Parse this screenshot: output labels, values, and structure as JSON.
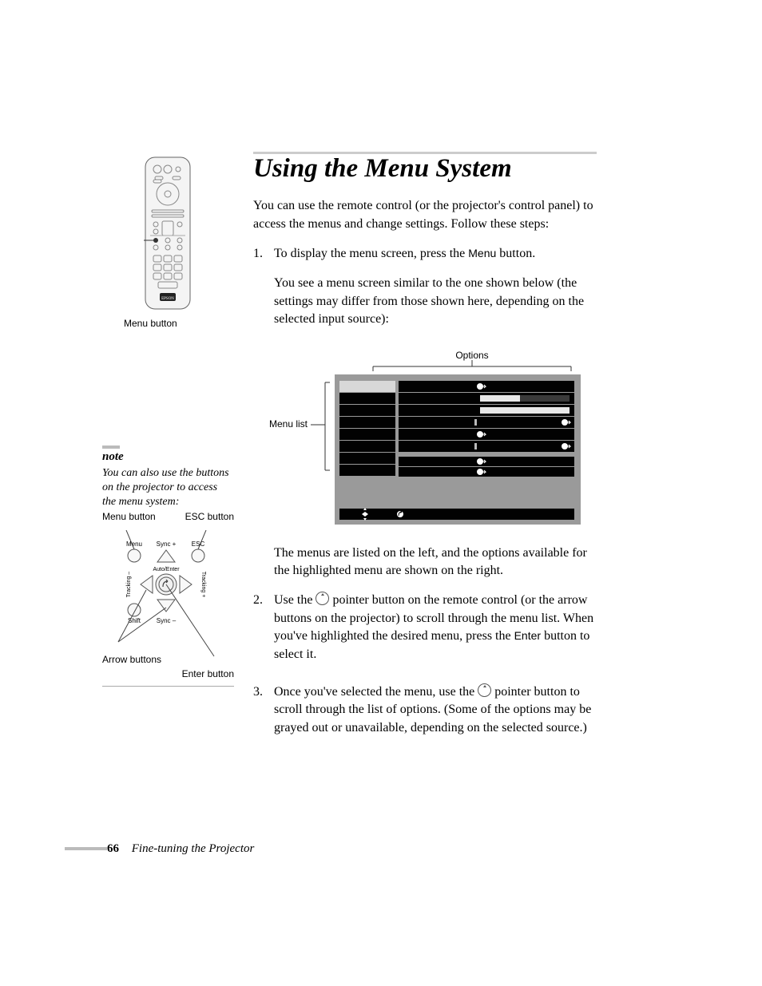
{
  "heading": "Using the Menu System",
  "intro": "You can use the remote control (or the projector's control panel) to access the menus and change settings. Follow these steps:",
  "steps": {
    "s1_num": "1.",
    "s1_a_pre": "To display the menu screen, press the ",
    "s1_a_ui": "Menu",
    "s1_a_post": " button.",
    "s1_b": "You see a menu screen similar to the one shown below (the settings may differ from those shown here, depending on the selected input source):",
    "s_mid": "The menus are listed on the left, and the options available for the highlighted menu are shown on the right.",
    "s2_num": "2.",
    "s2_pre": "Use the ",
    "s2_mid": " pointer button on the remote control (or the arrow buttons on the projector) to scroll through the menu list. When you've highlighted the desired menu, press the ",
    "s2_ui": "Enter",
    "s2_post": " button to select it.",
    "s3_num": "3.",
    "s3_pre": "Once you've selected the menu, use the ",
    "s3_post": " pointer button to scroll through the list of options. (Some of the options may be grayed out or unavailable, depending on the selected source.)"
  },
  "remote_caption": "Menu button",
  "note": {
    "heading": "note",
    "text": "You can also use the buttons on the projector to access the menu system:"
  },
  "panel": {
    "menu_label": "Menu button",
    "esc_label": "ESC button",
    "menu": "Menu",
    "syncp": "Sync +",
    "esc": "ESC",
    "auto": "Auto/Enter",
    "shift": "Shift",
    "syncm": "Sync –",
    "trackm": "Tracking –",
    "trackp": "Tracking +",
    "arrow_label": "Arrow buttons",
    "enter_label": "Enter button"
  },
  "figure": {
    "options_label": "Options",
    "menulist_label": "Menu list"
  },
  "footer": {
    "page": "66",
    "title": "Fine-tuning the Projector"
  }
}
